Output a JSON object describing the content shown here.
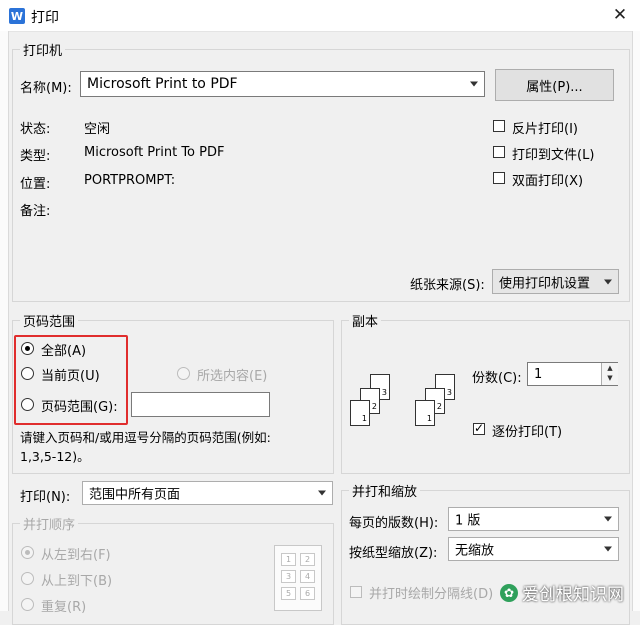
{
  "window": {
    "title": "打印",
    "app_icon_letter": "W"
  },
  "printer": {
    "group_label": "打印机",
    "name_label": "名称(M):",
    "name_value": "Microsoft Print to PDF",
    "properties_button": "属性(P)...",
    "status_label": "状态:",
    "status_value": "空闲",
    "type_label": "类型:",
    "type_value": "Microsoft Print To PDF",
    "location_label": "位置:",
    "location_value": "PORTPROMPT:",
    "comment_label": "备注:",
    "options": [
      {
        "label": "反片打印(I)",
        "checked": false
      },
      {
        "label": "打印到文件(L)",
        "checked": false
      },
      {
        "label": "双面打印(X)",
        "checked": false
      }
    ],
    "paper_source_label": "纸张来源(S):",
    "paper_source_value": "使用打印机设置"
  },
  "page_range": {
    "group_label": "页码范围",
    "all": "全部(A)",
    "current": "当前页(U)",
    "selection": "所选内容(E)",
    "pages": "页码范围(G):",
    "pages_value": "",
    "hint_line1": "请键入页码和/或用逗号分隔的页码范围(例如:",
    "hint_line2": "1,3,5-12)。",
    "selected": "all"
  },
  "copies": {
    "group_label": "副本",
    "count_label": "份数(C):",
    "count_value": "1",
    "collate_label": "逐份打印(T)",
    "collate_checked": true,
    "collated_pages": [
      "3",
      "2",
      "1",
      "3",
      "2",
      "1"
    ]
  },
  "print_what": {
    "label": "打印(N):",
    "value": "范围中所有页面"
  },
  "print_order": {
    "group_label": "并打顺序",
    "options": [
      "从左到右(F)",
      "从上到下(B)",
      "重复(R)"
    ],
    "grid_numbers": [
      "1",
      "2",
      "3",
      "4",
      "5",
      "6"
    ]
  },
  "zoom": {
    "group_label": "并打和缩放",
    "pages_per_sheet_label": "每页的版数(H):",
    "pages_per_sheet_value": "1 版",
    "scale_label": "按纸型缩放(Z):",
    "scale_value": "无缩放",
    "draw_borders_label": "并打时绘制分隔线(D)"
  },
  "watermark": {
    "text": "爱创根知识网",
    "icon": "leaf-icon"
  },
  "colors": {
    "highlight_red": "#e02d2d",
    "app_blue": "#2b73d8"
  }
}
